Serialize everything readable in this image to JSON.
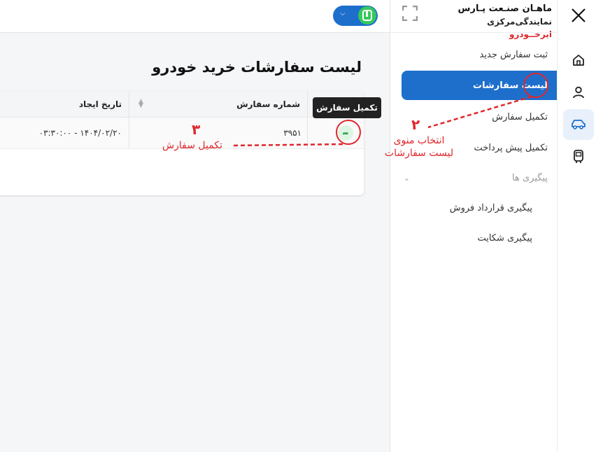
{
  "brand": {
    "line1": "ماهـان صنـعت پـارس",
    "line2_prefix": "نمایندگی‌مرکزی",
    "line2_brand": "ایرخــودرو"
  },
  "page": {
    "title": "لیست سفارشات خرید خودرو"
  },
  "sidebar": {
    "items": [
      {
        "label": "ثبت سفارش جدید"
      },
      {
        "label": "لیست سفارشات"
      },
      {
        "label": "تکمیل سفارش"
      },
      {
        "label": "تکمیل پیش پرداخت"
      },
      {
        "label": "پیگیری ها"
      },
      {
        "label": "پیگیری قرارداد فروش"
      },
      {
        "label": "پیگیری شکایت"
      }
    ]
  },
  "table": {
    "columns": [
      "شماره سفارش",
      "تاریخ ایجاد"
    ],
    "rows": [
      {
        "order_number": "۳۹۵۱",
        "created": "۱۴۰۴/۰۲/۲۰ - ۰۳:۳۰:۰۰"
      }
    ]
  },
  "tooltip": {
    "text": "تکمیل سفارش"
  },
  "annotations": {
    "step2_number": "۲",
    "step2_line1": "انتخاب منوی",
    "step2_line2": "لیست سفارشات",
    "step3_number": "۳",
    "step3_text": "تکمیل سفارش"
  },
  "icons": {
    "close": "close-icon",
    "fullscreen": "fullscreen-icon",
    "home": "home-icon",
    "user": "user-icon",
    "car": "car-icon",
    "bus": "bus-icon",
    "chevron": "chevron-down-icon",
    "sort": "sort-icon",
    "action": "complete-order-icon"
  },
  "colors": {
    "accent": "#1e6fcc",
    "annotation": "#e0262b",
    "success": "#2fa84f"
  }
}
